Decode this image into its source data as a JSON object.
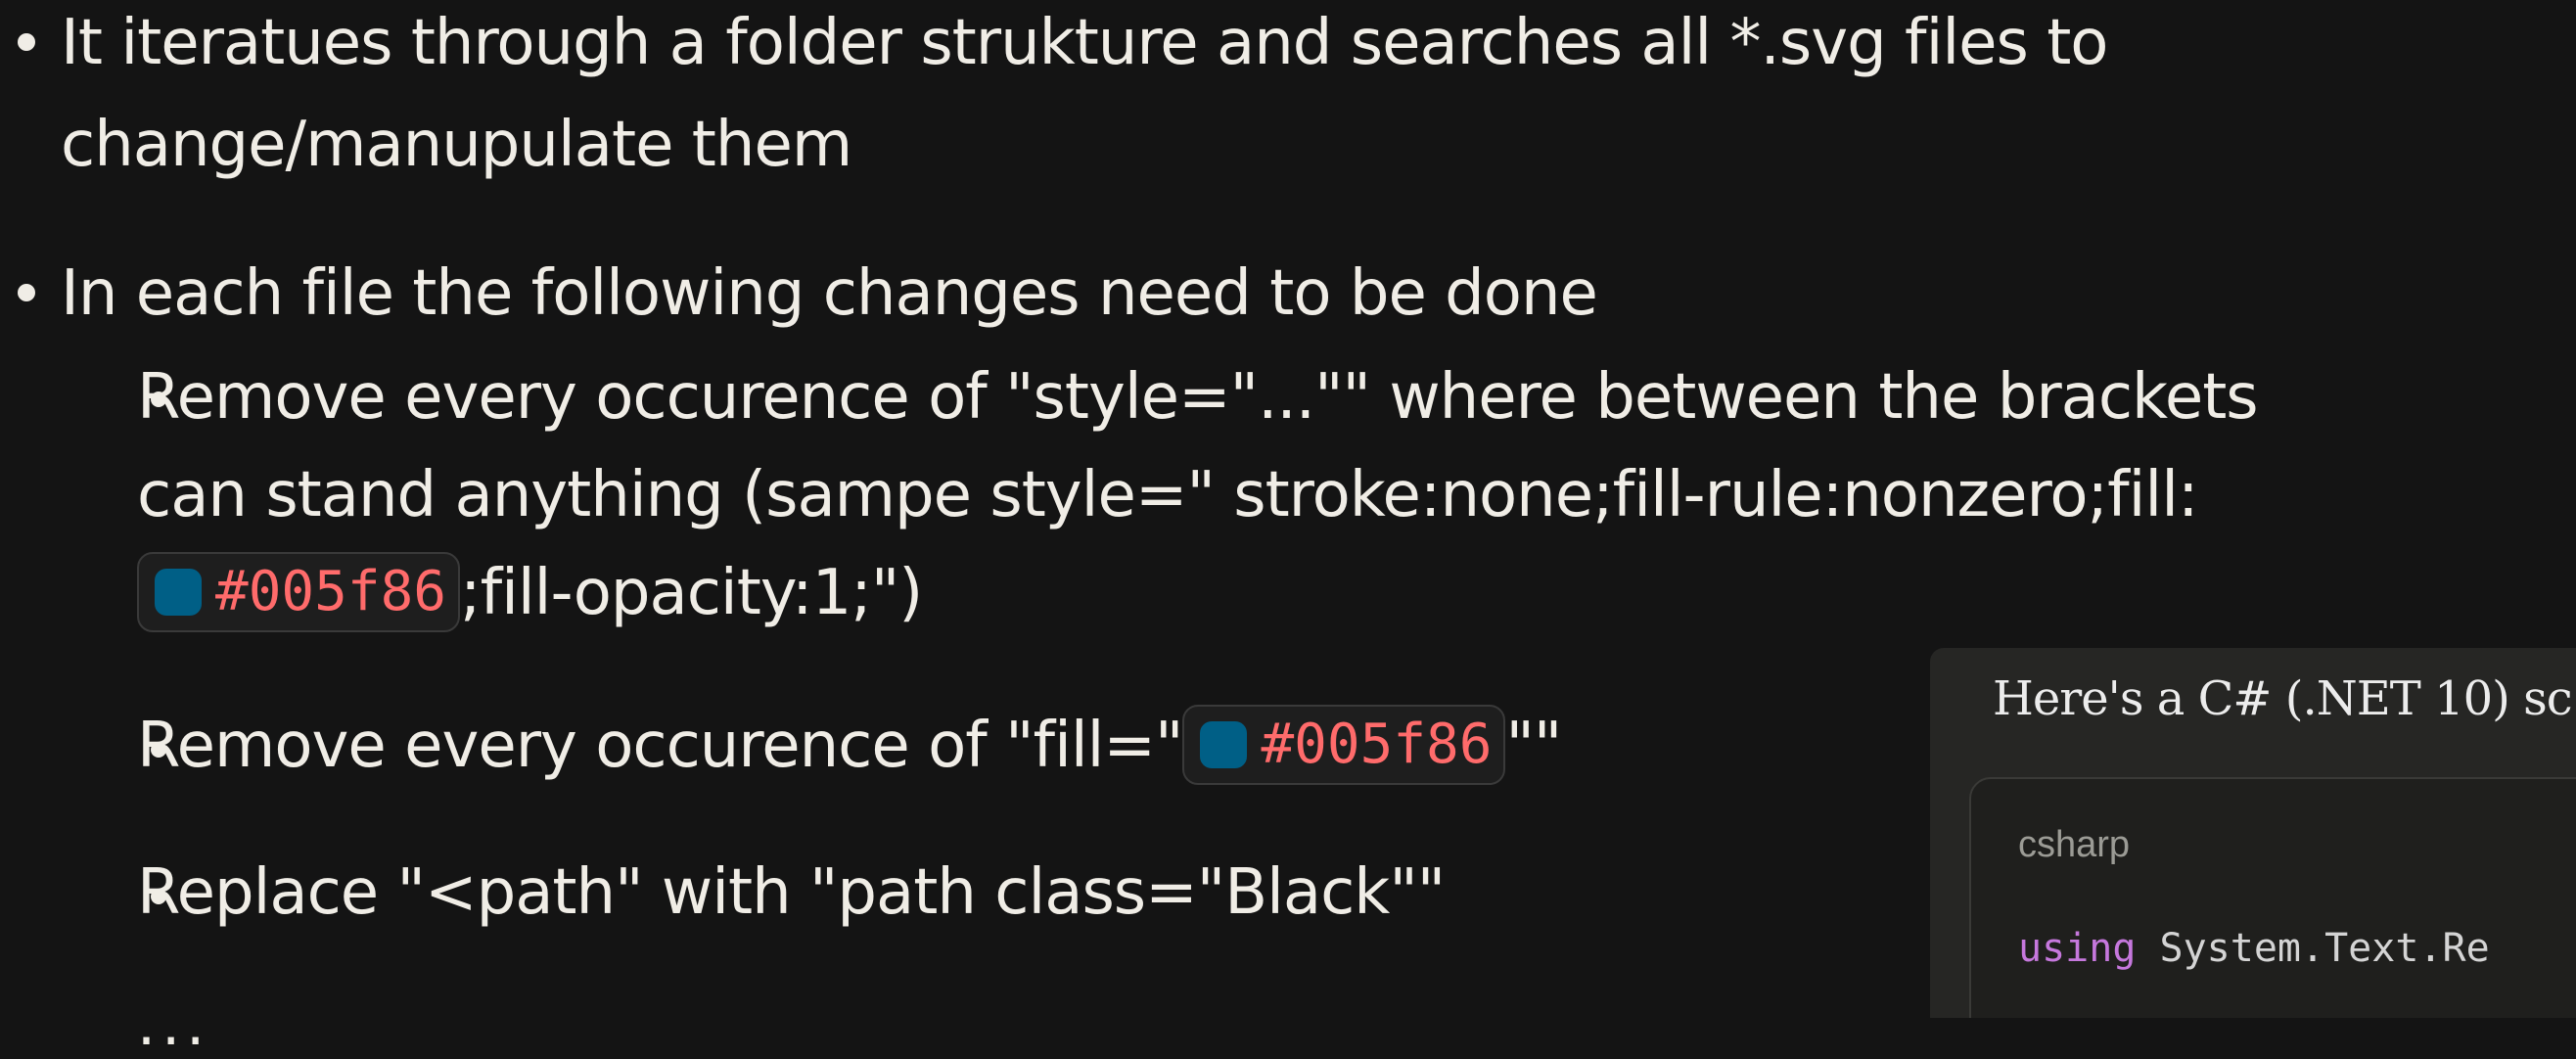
{
  "bullets": {
    "item1": {
      "line1": "It iteratues through a folder strukture and searches all *.svg files to",
      "line2": "change/manupulate them"
    },
    "item2": {
      "label": "In each file the following changes need to be done"
    },
    "sub1": {
      "line1": "Remove every occurence of \"style=\"...\"\" where between the brackets",
      "line2": "can stand anything (sampe style=\" stroke:none;fill-rule:nonzero;fill:",
      "line3_after": ";fill-opacity:1;\")",
      "color_code": "#005f86",
      "color_swatch": "#005f86"
    },
    "sub2": {
      "before": "Remove every occurence of \"fill=\"",
      "color_code": "#005f86",
      "after": "\"\"",
      "color_swatch": "#005f86"
    },
    "sub3": {
      "label": "Replace \"<path\" with \"path class=\"Black\"\""
    },
    "more": "..."
  },
  "response": {
    "intro": "Here's a C# (.NET 10) sc",
    "code_lang": "csharp",
    "code_keyword": "using",
    "code_rest": " System.Text.Re"
  },
  "colors": {
    "background": "#141414",
    "text": "#f0ede6",
    "code_text": "#ff6b6b",
    "keyword": "#c678dd"
  }
}
